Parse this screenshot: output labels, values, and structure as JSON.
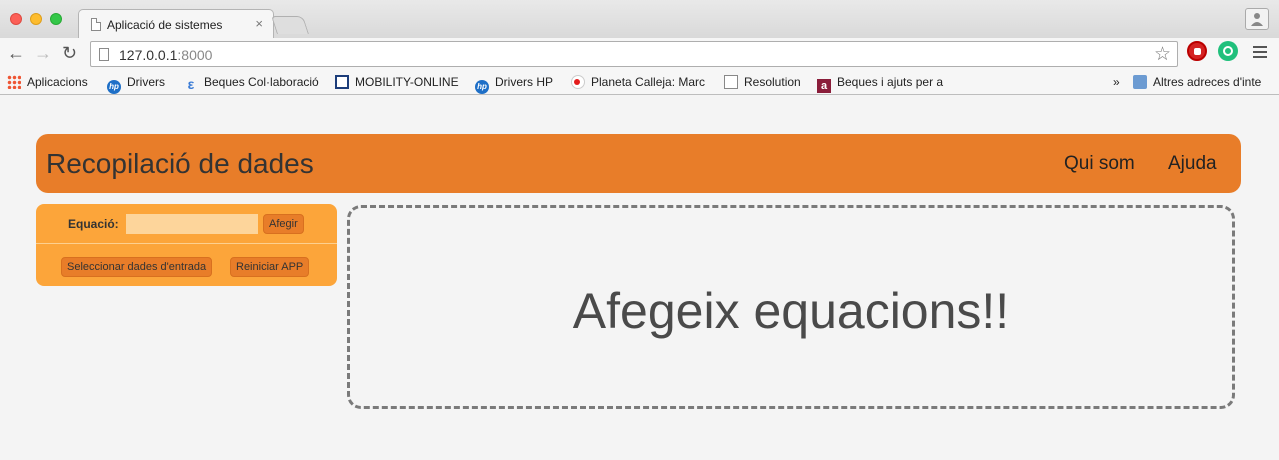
{
  "browser": {
    "tab_title": "Aplicació de sistemes",
    "tab_close": "×",
    "url_host": "127.0.0.1",
    "url_port": ":8000",
    "bookmarks": [
      {
        "label": "Aplicacions",
        "icon": "apps-grid-icon"
      },
      {
        "label": "Drivers",
        "icon": "hp-icon"
      },
      {
        "label": "Beques Col·laboració",
        "icon": "e-logo-icon"
      },
      {
        "label": "MOBILITY-ONLINE",
        "icon": "mobility-icon"
      },
      {
        "label": "Drivers HP",
        "icon": "hp-icon"
      },
      {
        "label": "Planeta Calleja: Marc",
        "icon": "planet-icon"
      },
      {
        "label": "Resolution",
        "icon": "document-icon"
      },
      {
        "label": "Beques i ajuts per a",
        "icon": "a-logo-icon"
      },
      {
        "label": "»",
        "icon": "overflow-chevron"
      },
      {
        "label": "Altres adreces d'inte",
        "icon": "folder-icon"
      }
    ]
  },
  "app": {
    "title": "Recopilació de dades",
    "nav": [
      "Qui som",
      "Ajuda"
    ],
    "form": {
      "equation_label": "Equació:",
      "equation_value": "",
      "add_button": "Afegir",
      "select_input_button": "Seleccionar dades d'entrada",
      "reset_button": "Reiniciar APP"
    },
    "empty_message": "Afegeix equacions!!"
  },
  "colors": {
    "header": "#e87d29",
    "panel": "#fca53a",
    "button": "#e87d29",
    "input": "#fdd59b"
  }
}
